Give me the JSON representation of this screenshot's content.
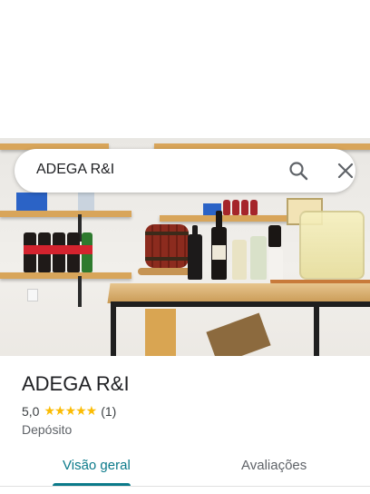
{
  "search": {
    "query": "ADEGA R&I"
  },
  "place": {
    "name": "ADEGA R&I",
    "rating": "5,0",
    "stars": "★★★★★",
    "review_count": "(1)",
    "category": "Depósito"
  },
  "tabs": [
    {
      "label": "Visão geral",
      "selected": true
    },
    {
      "label": "Avaliações",
      "selected": false
    }
  ],
  "colors": {
    "accent": "#0b7a8a",
    "star": "#fbbc04"
  }
}
